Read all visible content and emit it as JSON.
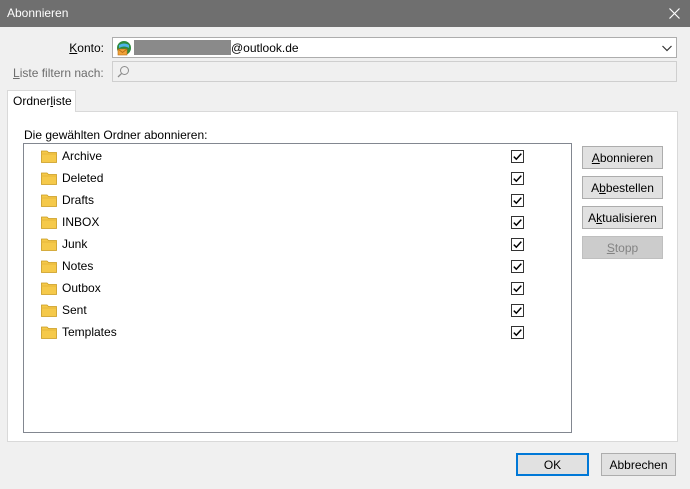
{
  "window": {
    "title": "Abonnieren"
  },
  "konto": {
    "label_prefix": "",
    "label_hotkey": "K",
    "label_rest": "onto:",
    "account_domain": "@outlook.de"
  },
  "filter": {
    "label_hotkey": "L",
    "label_rest": "iste filtern nach:",
    "value": ""
  },
  "tab": {
    "label_pre": "Ordner",
    "label_hotkey": "l",
    "label_post": "iste"
  },
  "panel": {
    "label": "Die gewählten Ordner abonnieren:"
  },
  "folders": [
    {
      "name": "Archive",
      "checked": true
    },
    {
      "name": "Deleted",
      "checked": true
    },
    {
      "name": "Drafts",
      "checked": true
    },
    {
      "name": "INBOX",
      "checked": true
    },
    {
      "name": "Junk",
      "checked": true
    },
    {
      "name": "Notes",
      "checked": true
    },
    {
      "name": "Outbox",
      "checked": true
    },
    {
      "name": "Sent",
      "checked": true
    },
    {
      "name": "Templates",
      "checked": true
    }
  ],
  "buttons": {
    "subscribe": {
      "hotkey": "A",
      "rest": "bonnieren"
    },
    "unsubscribe": {
      "pre": "A",
      "hotkey": "b",
      "rest": "bestellen"
    },
    "refresh": {
      "pre": "A",
      "hotkey": "k",
      "rest": "tualisieren"
    },
    "stop": {
      "hotkey": "S",
      "rest": "topp"
    },
    "ok": "OK",
    "cancel": "Abbrechen"
  },
  "icons": {
    "close": "close-icon",
    "account": "account-icon",
    "search": "search-icon",
    "folder": "folder-icon",
    "chevron": "chevron-down-icon"
  },
  "colors": {
    "titlebar": "#6f6f6f",
    "folder": "#f5c94a",
    "default_button_border": "#0078d7"
  }
}
